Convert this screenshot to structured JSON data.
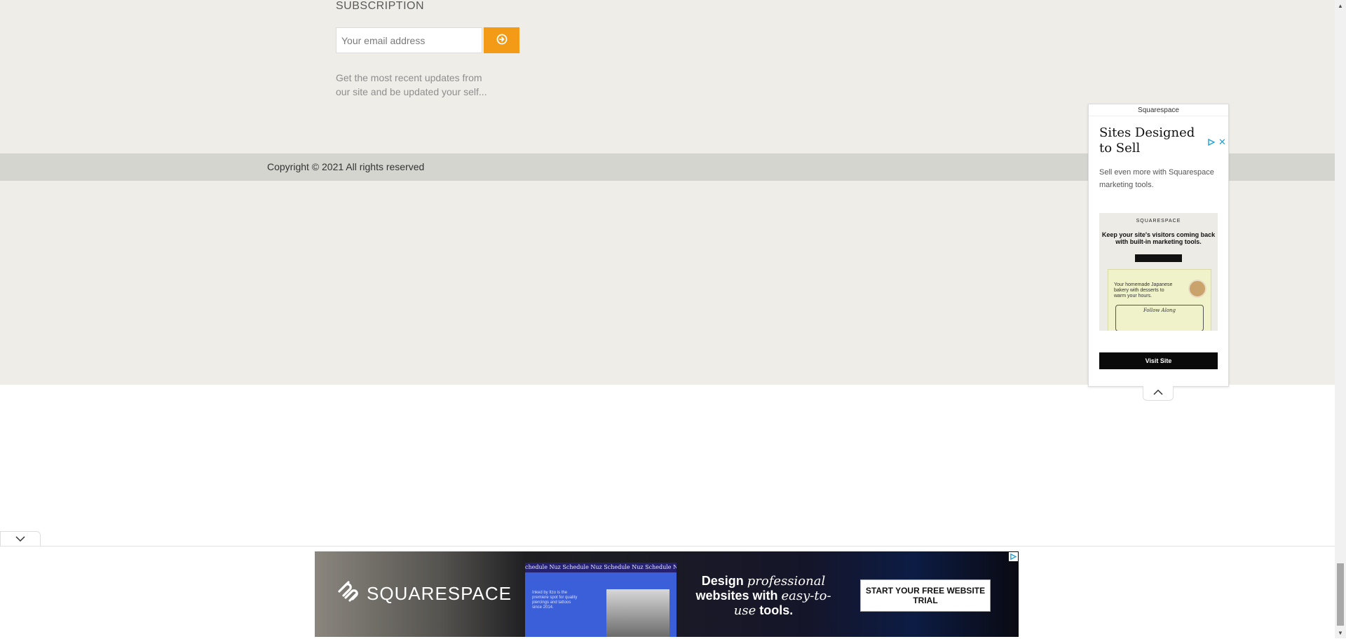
{
  "subscription": {
    "heading": "SUBSCRIPTION",
    "email_placeholder": "Your email address",
    "submit_icon": "arrow-circle-right-icon",
    "description": "Get the most recent updates from our site and be updated your self..."
  },
  "footer": {
    "copyright": "Copyright © 2021 All rights reserved"
  },
  "side_ad": {
    "sponsor": "Squarespace",
    "title": "Sites Designed to Sell",
    "description": "Sell even more with Squarespace marketing tools.",
    "image": {
      "logo": "SQUARESPACE",
      "headline": "Keep your site's visitors coming back with built-in marketing tools.",
      "mini_text": "Your homemade Japanese bakery with desserts to warm your hours.",
      "mini_follow": "Follow Along"
    },
    "cta": "Visit Site",
    "icons": [
      "ad-choices-icon",
      "close-icon",
      "chevron-up-icon"
    ]
  },
  "bottom_banner": {
    "brand": "SQUARESPACE",
    "tile_bar": "chedule Nuz   Schedule Nuz   Schedule Nuz   Schedule Nuz",
    "tile_text": "Inked by Itzo is the premiere spot for quality piercings and tattoos since 2014.",
    "headline_part1": "Design ",
    "headline_italic1": "professional",
    "headline_part2": " websites with ",
    "headline_italic2": "easy-to-use",
    "headline_part3": " tools.",
    "cta": "START YOUR FREE WEBSITE TRIAL",
    "icons": [
      "squarespace-logo-icon",
      "ad-choices-icon",
      "chevron-down-icon"
    ]
  },
  "colors": {
    "accent": "#f39b17",
    "footer_bg": "#efede8",
    "copyright_bg": "#d5d5d0"
  }
}
